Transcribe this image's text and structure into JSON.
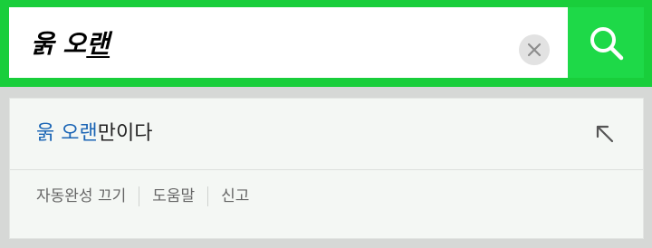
{
  "search": {
    "query_prefix": "욹 오",
    "query_composing": "랜",
    "value": "욹 오랜"
  },
  "icons": {
    "clear": "clear-x-icon",
    "search": "magnifier-icon",
    "fill": "arrow-up-left-icon"
  },
  "colors": {
    "brand_green": "#19ce3b",
    "search_button_green": "#1ed948",
    "match_blue": "#1b65b5"
  },
  "suggestions": [
    {
      "match": "욹 오랜",
      "rest": "만이다"
    }
  ],
  "footer": {
    "autocomplete_off": "자동완성 끄기",
    "help": "도움말",
    "report": "신고"
  }
}
